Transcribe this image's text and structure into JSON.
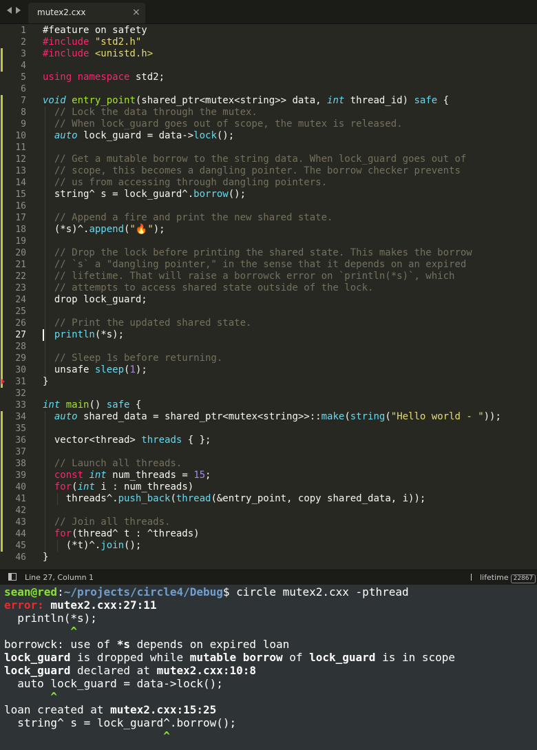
{
  "tab": {
    "title": "mutex2.cxx",
    "close_glyph": "×"
  },
  "editor": {
    "current_line": 27,
    "line_numbers": [
      "1",
      "2",
      "3",
      "4",
      "5",
      "6",
      "7",
      "8",
      "9",
      "10",
      "11",
      "12",
      "13",
      "14",
      "15",
      "16",
      "17",
      "18",
      "19",
      "20",
      "21",
      "22",
      "23",
      "24",
      "25",
      "26",
      "27",
      "28",
      "29",
      "30",
      "31",
      "32",
      "33",
      "34",
      "35",
      "36",
      "37",
      "38",
      "39",
      "40",
      "41",
      "42",
      "43",
      "44",
      "45",
      "46"
    ],
    "lines": [
      [
        {
          "t": "#feature on safety",
          "c": ""
        }
      ],
      [
        {
          "t": "#include ",
          "c": "pp"
        },
        {
          "t": "\"std2.h\"",
          "c": "str"
        }
      ],
      [
        {
          "t": "#include ",
          "c": "pp"
        },
        {
          "t": "<unistd.h>",
          "c": "str"
        }
      ],
      [],
      [
        {
          "t": "using namespace ",
          "c": "kw"
        },
        {
          "t": "std2;",
          "c": ""
        }
      ],
      [],
      [
        {
          "t": "void",
          "c": "ty"
        },
        {
          "t": " ",
          "c": ""
        },
        {
          "t": "entry_point",
          "c": "fn"
        },
        {
          "t": "(shared_ptr<mutex<string>> data, ",
          "c": ""
        },
        {
          "t": "int",
          "c": "ty"
        },
        {
          "t": " thread_id) ",
          "c": ""
        },
        {
          "t": "safe",
          "c": "sf"
        },
        {
          "t": " {",
          "c": ""
        }
      ],
      [
        {
          "t": "  // Lock the data through the mutex.",
          "c": "cm"
        }
      ],
      [
        {
          "t": "  // When lock_guard goes out of scope, the mutex is released.",
          "c": "cm"
        }
      ],
      [
        {
          "t": "  ",
          "c": ""
        },
        {
          "t": "auto",
          "c": "ty"
        },
        {
          "t": " lock_guard = data->",
          "c": ""
        },
        {
          "t": "lock",
          "c": "ca"
        },
        {
          "t": "();",
          "c": ""
        }
      ],
      [],
      [
        {
          "t": "  // Get a mutable borrow to the string data. When lock_guard goes out of",
          "c": "cm"
        }
      ],
      [
        {
          "t": "  // scope, this becomes a dangling pointer. The borrow checker prevents",
          "c": "cm"
        }
      ],
      [
        {
          "t": "  // us from accessing through dangling pointers.",
          "c": "cm"
        }
      ],
      [
        {
          "t": "  string^ s = lock_guard^.",
          "c": ""
        },
        {
          "t": "borrow",
          "c": "ca"
        },
        {
          "t": "();",
          "c": ""
        }
      ],
      [],
      [
        {
          "t": "  // Append a fire and print the new shared state.",
          "c": "cm"
        }
      ],
      [
        {
          "t": "  (*s)^.",
          "c": ""
        },
        {
          "t": "append",
          "c": "ca"
        },
        {
          "t": "(",
          "c": ""
        },
        {
          "t": "\"🔥\"",
          "c": "str"
        },
        {
          "t": ");",
          "c": ""
        }
      ],
      [],
      [
        {
          "t": "  // Drop the lock before printing the shared state. This makes the borrow",
          "c": "cm"
        }
      ],
      [
        {
          "t": "  // `s` a \"dangling pointer,\" in the sense that it depends on an expired",
          "c": "cm"
        }
      ],
      [
        {
          "t": "  // lifetime. That will raise a borrowck error on `println(*s)`, which",
          "c": "cm"
        }
      ],
      [
        {
          "t": "  // attempts to access shared state outside of the lock.",
          "c": "cm"
        }
      ],
      [
        {
          "t": "  drop lock_guard;",
          "c": ""
        }
      ],
      [],
      [
        {
          "t": "  // Print the updated shared state.",
          "c": "cm"
        }
      ],
      [
        {
          "t": "  ",
          "c": ""
        },
        {
          "t": "println",
          "c": "ca"
        },
        {
          "t": "(*s);",
          "c": ""
        }
      ],
      [],
      [
        {
          "t": "  // Sleep 1s before returning.",
          "c": "cm"
        }
      ],
      [
        {
          "t": "  unsafe ",
          "c": ""
        },
        {
          "t": "sleep",
          "c": "ca"
        },
        {
          "t": "(",
          "c": ""
        },
        {
          "t": "1",
          "c": "num"
        },
        {
          "t": ");",
          "c": ""
        }
      ],
      [
        {
          "t": "}",
          "c": ""
        }
      ],
      [],
      [
        {
          "t": "int",
          "c": "ty"
        },
        {
          "t": " ",
          "c": ""
        },
        {
          "t": "main",
          "c": "fn"
        },
        {
          "t": "() ",
          "c": ""
        },
        {
          "t": "safe",
          "c": "sf"
        },
        {
          "t": " {",
          "c": ""
        }
      ],
      [
        {
          "t": "  ",
          "c": ""
        },
        {
          "t": "auto",
          "c": "ty"
        },
        {
          "t": " shared_data = shared_ptr<mutex<string>>::",
          "c": ""
        },
        {
          "t": "make",
          "c": "ca"
        },
        {
          "t": "(",
          "c": ""
        },
        {
          "t": "string",
          "c": "ca"
        },
        {
          "t": "(",
          "c": ""
        },
        {
          "t": "\"Hello world - \"",
          "c": "str"
        },
        {
          "t": "));",
          "c": ""
        }
      ],
      [],
      [
        {
          "t": "  vector<thread> ",
          "c": ""
        },
        {
          "t": "threads",
          "c": "ca"
        },
        {
          "t": " { };",
          "c": ""
        }
      ],
      [],
      [
        {
          "t": "  // Launch all threads.",
          "c": "cm"
        }
      ],
      [
        {
          "t": "  ",
          "c": ""
        },
        {
          "t": "const",
          "c": "kw"
        },
        {
          "t": " ",
          "c": ""
        },
        {
          "t": "int",
          "c": "ty"
        },
        {
          "t": " num_threads = ",
          "c": ""
        },
        {
          "t": "15",
          "c": "num"
        },
        {
          "t": ";",
          "c": ""
        }
      ],
      [
        {
          "t": "  ",
          "c": ""
        },
        {
          "t": "for",
          "c": "kw"
        },
        {
          "t": "(",
          "c": ""
        },
        {
          "t": "int",
          "c": "ty"
        },
        {
          "t": " i : num_threads)",
          "c": ""
        }
      ],
      [
        {
          "t": "    threads^.",
          "c": ""
        },
        {
          "t": "push_back",
          "c": "ca"
        },
        {
          "t": "(",
          "c": ""
        },
        {
          "t": "thread",
          "c": "ca"
        },
        {
          "t": "(&entry_point, copy shared_data, i));",
          "c": ""
        }
      ],
      [],
      [
        {
          "t": "  // Join all threads.",
          "c": "cm"
        }
      ],
      [
        {
          "t": "  ",
          "c": ""
        },
        {
          "t": "for",
          "c": "kw"
        },
        {
          "t": "(thread^ t : ^threads)",
          "c": ""
        }
      ],
      [
        {
          "t": "    (*t)^.",
          "c": ""
        },
        {
          "t": "join",
          "c": "ca"
        },
        {
          "t": "();",
          "c": ""
        }
      ],
      [
        {
          "t": "}",
          "c": ""
        }
      ]
    ]
  },
  "statusbar": {
    "position": "Line 27, Column 1",
    "branch": "lifetime",
    "count": "22867"
  },
  "terminal": {
    "lines": [
      [
        {
          "t": "sean@red",
          "c": "t-green"
        },
        {
          "t": ":",
          "c": ""
        },
        {
          "t": "~/projects/circle4/Debug",
          "c": "t-blue"
        },
        {
          "t": "$ circle mutex2.cxx -pthread",
          "c": ""
        }
      ],
      [
        {
          "t": "error: ",
          "c": "t-red"
        },
        {
          "t": "mutex2.cxx:27:11",
          "c": "t-bold"
        }
      ],
      [
        {
          "t": "  println(*s);",
          "c": ""
        }
      ],
      [
        {
          "t": "          ^",
          "c": "t-green"
        }
      ],
      [
        {
          "t": "borrowck: use of ",
          "c": ""
        },
        {
          "t": "*s",
          "c": "t-bold"
        },
        {
          "t": " depends on expired loan",
          "c": ""
        }
      ],
      [
        {
          "t": "lock_guard",
          "c": "t-bold"
        },
        {
          "t": " is dropped while ",
          "c": ""
        },
        {
          "t": "mutable borrow",
          "c": "t-bold"
        },
        {
          "t": " of ",
          "c": ""
        },
        {
          "t": "lock_guard",
          "c": "t-bold"
        },
        {
          "t": " is in scope",
          "c": ""
        }
      ],
      [
        {
          "t": "lock_guard",
          "c": "t-bold"
        },
        {
          "t": " declared at ",
          "c": ""
        },
        {
          "t": "mutex2.cxx:10:8",
          "c": "t-bold"
        }
      ],
      [
        {
          "t": "  auto lock_guard = data->lock();",
          "c": ""
        }
      ],
      [
        {
          "t": "       ^",
          "c": "t-green"
        }
      ],
      [
        {
          "t": "loan created at ",
          "c": ""
        },
        {
          "t": "mutex2.cxx:15:25",
          "c": "t-bold"
        }
      ],
      [
        {
          "t": "  string^ s = lock_guard^.borrow();",
          "c": ""
        }
      ],
      [
        {
          "t": "                        ^",
          "c": "t-green"
        }
      ]
    ]
  },
  "colors": {
    "editor_bg": "#272822",
    "terminal_bg": "#2e3436",
    "modified_marker": "#c4c44a",
    "error_marker": "#e0303a"
  },
  "icons": {
    "nav_back": "left-arrow-icon",
    "nav_forward": "right-arrow-icon",
    "panel": "panel-icon",
    "branch": "git-branch-icon"
  }
}
